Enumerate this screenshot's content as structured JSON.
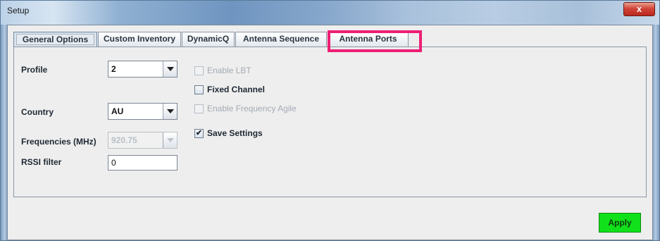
{
  "window": {
    "title": "Setup",
    "close_glyph": "x"
  },
  "tabs": [
    {
      "label": "General Options",
      "active": true
    },
    {
      "label": "Custom Inventory",
      "active": false
    },
    {
      "label": "DynamicQ",
      "active": false
    },
    {
      "label": "Antenna Sequence",
      "active": false
    },
    {
      "label": "Antenna Ports",
      "active": false,
      "highlighted": true
    }
  ],
  "form": {
    "profile": {
      "label": "Profile",
      "value": "2"
    },
    "country": {
      "label": "Country",
      "value": "AU"
    },
    "frequencies": {
      "label": "Frequencies (MHz)",
      "value": "920.75"
    },
    "rssi_filter": {
      "label": "RSSI filter",
      "value": "0"
    }
  },
  "options": {
    "enable_lbt": {
      "label": "Enable LBT",
      "checked": false,
      "enabled": false
    },
    "fixed_channel": {
      "label": "Fixed Channel",
      "checked": false,
      "enabled": true
    },
    "enable_frequency_agile": {
      "label": "Enable Frequency Agile",
      "checked": false,
      "enabled": false
    },
    "save_settings": {
      "label": "Save Settings",
      "checked": true,
      "enabled": true,
      "check_glyph": "✔"
    }
  },
  "actions": {
    "apply_label": "Apply"
  },
  "colors": {
    "highlight_border": "#ee1f74",
    "apply_button": "#11e11a"
  }
}
